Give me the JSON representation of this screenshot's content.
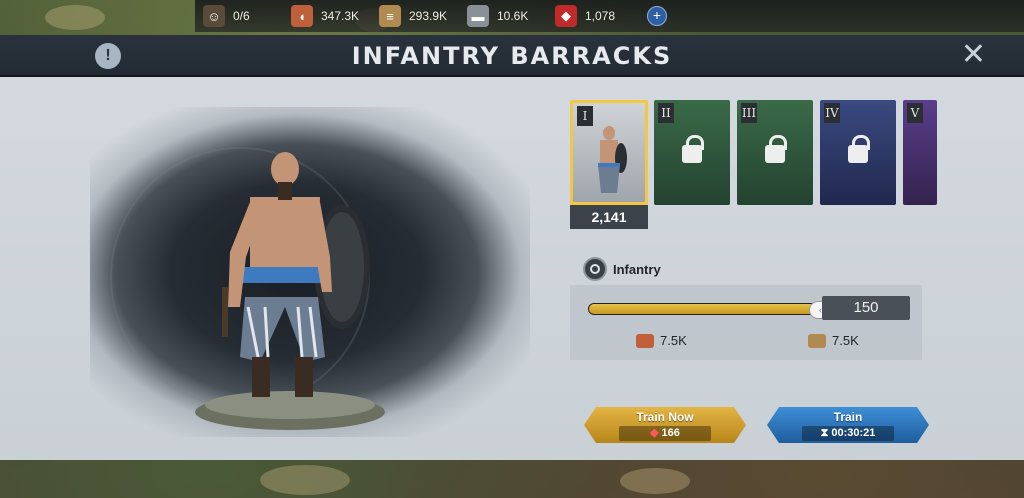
{
  "resources": {
    "troops": {
      "icon": "soldier-icon",
      "value": "0/6"
    },
    "food": {
      "icon": "meat-icon",
      "value": "347.3K"
    },
    "wood": {
      "icon": "wood-icon",
      "value": "293.9K"
    },
    "iron": {
      "icon": "iron-icon",
      "value": "10.6K"
    },
    "gems": {
      "icon": "gem-icon",
      "value": "1,078"
    },
    "add_icon": "plus-icon"
  },
  "header": {
    "title": "INFANTRY BARRACKS",
    "info_glyph": "!",
    "close_glyph": "✕"
  },
  "levels": [
    {
      "roman": "I",
      "selected": true,
      "locked": false,
      "color": "#c9cdd1"
    },
    {
      "roman": "II",
      "selected": false,
      "locked": true,
      "color": "#2e5a3c"
    },
    {
      "roman": "III",
      "selected": false,
      "locked": true,
      "color": "#2e5a3c"
    },
    {
      "roman": "IV",
      "selected": false,
      "locked": true,
      "color": "#2c3b6e"
    },
    {
      "roman": "V",
      "selected": false,
      "locked": true,
      "color": "#4a3475"
    }
  ],
  "selected_count": "2,141",
  "troop_type": "Infantry",
  "training": {
    "quantity": "150",
    "fill_fraction": 1.0,
    "food_cost": "7.5K",
    "wood_cost": "7.5K"
  },
  "buttons": {
    "train_now": {
      "label": "Train Now",
      "cost": "166"
    },
    "train": {
      "label": "Train",
      "time": "00:30:21"
    }
  },
  "colors": {
    "accent_gold": "#e3b544",
    "accent_blue": "#3e8ed6",
    "selected_border": "#f2c744"
  }
}
